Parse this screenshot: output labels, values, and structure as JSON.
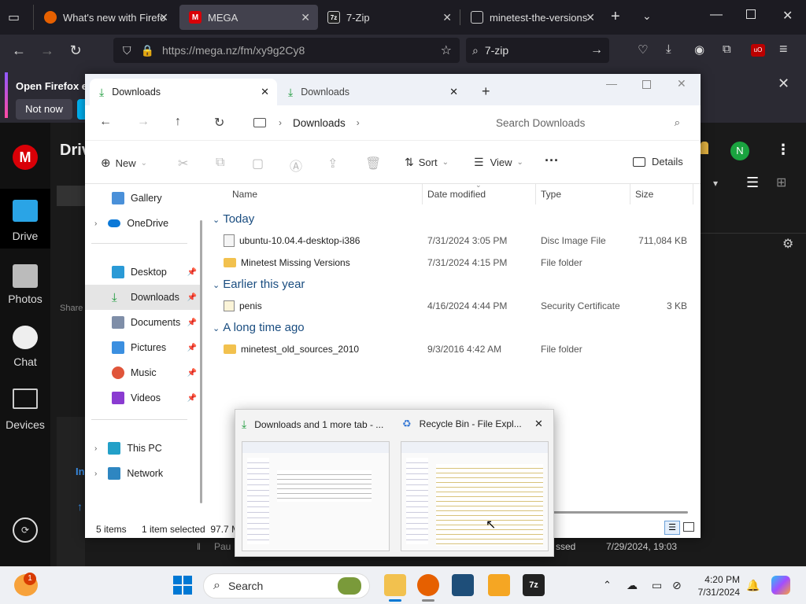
{
  "firefox": {
    "tabs": [
      {
        "title": "What's new with Firefo",
        "icon": "firefox-icon"
      },
      {
        "title": "MEGA",
        "icon": "mega-icon"
      },
      {
        "title": "7-Zip",
        "icon": "7zip-icon"
      },
      {
        "title": "minetest-the-versions",
        "icon": "github-icon"
      }
    ],
    "url": "https://mega.nz/fm/xy9g2Cy8",
    "search_value": "7-zip",
    "notification_text": "Open Firefox ev",
    "notification_button": "Not now",
    "avatar_letter": "N"
  },
  "mega": {
    "logo_letter": "M",
    "nav": [
      {
        "label": "Drive"
      },
      {
        "label": "Photos"
      },
      {
        "label": "Chat"
      },
      {
        "label": "Devices"
      }
    ],
    "header_partial": "Driv",
    "shared_partial": "Share",
    "transfer_status_partial": "ssed",
    "transfer_date": "7/29/2024, 19:03",
    "paused_partial": "Pau",
    "in_partial": "In"
  },
  "explorer": {
    "tabs": [
      {
        "label": "Downloads"
      },
      {
        "label": "Downloads"
      }
    ],
    "breadcrumb": "Downloads",
    "search_placeholder": "Search Downloads",
    "toolbar": {
      "new": "New",
      "sort": "Sort",
      "view": "View",
      "details": "Details"
    },
    "nav_items": [
      {
        "label": "Gallery"
      },
      {
        "label": "OneDrive"
      },
      {
        "label": "Desktop"
      },
      {
        "label": "Downloads"
      },
      {
        "label": "Documents"
      },
      {
        "label": "Pictures"
      },
      {
        "label": "Music"
      },
      {
        "label": "Videos"
      },
      {
        "label": "This PC"
      },
      {
        "label": "Network"
      }
    ],
    "columns": {
      "name": "Name",
      "date": "Date modified",
      "type": "Type",
      "size": "Size"
    },
    "groups": [
      {
        "label": "Today"
      },
      {
        "label": "Earlier this year"
      },
      {
        "label": "A long time ago"
      }
    ],
    "files": [
      {
        "name": "ubuntu-10.04.4-desktop-i386",
        "date": "7/31/2024 3:05 PM",
        "type": "Disc Image File",
        "size": "711,084 KB"
      },
      {
        "name": "Minetest Missing Versions",
        "date": "7/31/2024 4:15 PM",
        "type": "File folder",
        "size": ""
      },
      {
        "name": "penis",
        "date": "4/16/2024 4:44 PM",
        "type": "Security Certificate",
        "size": "3 KB"
      },
      {
        "name": "minetest_old_sources_2010",
        "date": "9/3/2016 4:42 AM",
        "type": "File folder",
        "size": ""
      }
    ],
    "status": {
      "items": "5 items",
      "selected": "1 item selected  97.7 M"
    }
  },
  "preview": {
    "windows": [
      {
        "title": "Downloads and 1 more tab - ..."
      },
      {
        "title": "Recycle Bin - File Expl..."
      }
    ]
  },
  "taskbar": {
    "search_label": "Search",
    "time": "4:20 PM",
    "date": "7/31/2024",
    "badge": "1"
  }
}
